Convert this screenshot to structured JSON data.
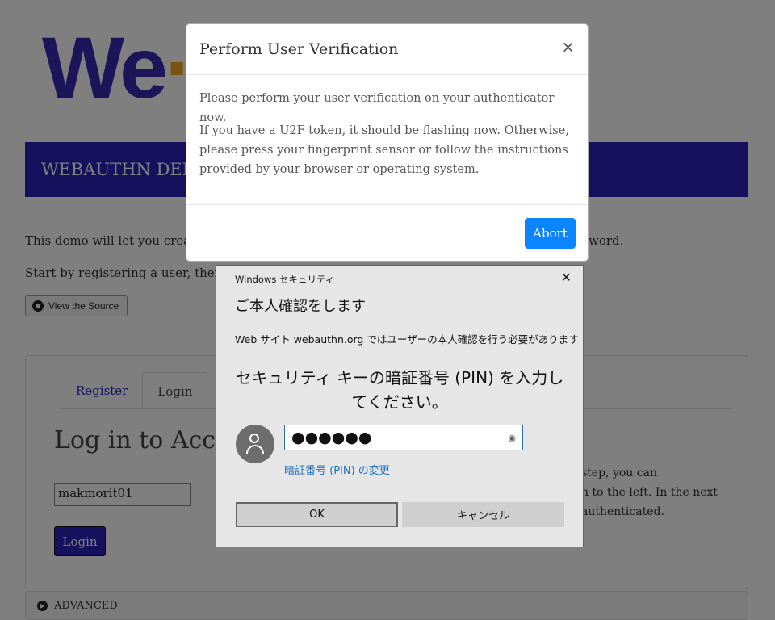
{
  "background": {
    "logo_text": "We",
    "logo_dot": "·",
    "banner_title": "WEBAUTHN DEMO",
    "intro_line1": "This demo will let you create a",
    "intro_line1_end": "word.",
    "intro_line2": "Start by registering a user, then try lo",
    "view_source_label": "View the Source",
    "tabs": [
      {
        "label": "Register"
      },
      {
        "label": "Login"
      }
    ],
    "login_title": "Log in to Account",
    "username_value": "makmorit01",
    "login_button": "Login",
    "side_text": [
      "step, you can",
      "n to the left. In the next",
      "authenticated."
    ],
    "advanced_label": "ADVANCED"
  },
  "modal": {
    "title": "Perform User Verification",
    "close_glyph": "×",
    "paragraph1": "Please perform your user verification on your authenticator now.",
    "paragraph2": "If you have a U2F token, it should be flashing now. Otherwise, please press your fingerprint sensor or follow the instructions provided by your browser or operating system.",
    "abort_button": "Abort",
    "abort_color": "#0a84ff"
  },
  "windows_dialog": {
    "title": "Windows セキュリティ",
    "close_glyph": "✕",
    "heading": "ご本人確認をします",
    "subtitle": "Web サイト webauthn.org ではユーザーの本人確認を行う必要があります",
    "prompt": "セキュリティ キーの暗証番号 (PIN) を入力してください。",
    "pin_masked": "●●●●●●",
    "pin_link": "暗証番号 (PIN) の変更",
    "ok_button": "OK",
    "cancel_button": "キャンセル",
    "accent_color": "#2b6cc4"
  }
}
